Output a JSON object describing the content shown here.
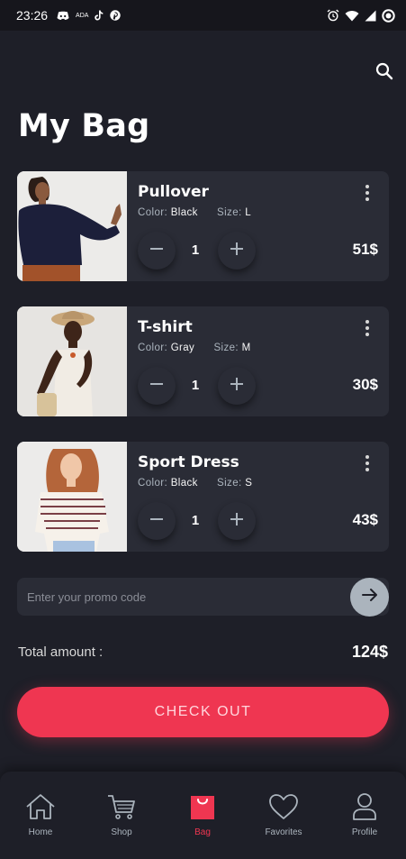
{
  "status_bar": {
    "time": "23:26",
    "small_label": "ADA",
    "icons": [
      "discord-icon",
      "ada-label",
      "tiktok-icon",
      "pinterest-icon",
      "alarm-icon",
      "wifi-icon",
      "signal-icon",
      "battery-icon"
    ]
  },
  "header": {
    "title": "My Bag",
    "search_icon": "search-icon"
  },
  "items": [
    {
      "name": "Pullover",
      "color_label": "Color:",
      "color": "Black",
      "size_label": "Size:",
      "size": "L",
      "qty": "1",
      "price": "51$",
      "photo": "woman-in-navy-pullover-photo"
    },
    {
      "name": "T-shirt",
      "color_label": "Color:",
      "color": "Gray",
      "size_label": "Size:",
      "size": "M",
      "qty": "1",
      "price": "30$",
      "photo": "woman-in-straw-hat-photo"
    },
    {
      "name": "Sport Dress",
      "color_label": "Color:",
      "color": "Black",
      "size_label": "Size:",
      "size": "S",
      "qty": "1",
      "price": "43$",
      "photo": "woman-in-striped-tee-photo"
    }
  ],
  "promo": {
    "placeholder": "Enter your promo code",
    "value": ""
  },
  "total": {
    "label": "Total amount :",
    "value": "124$"
  },
  "checkout": {
    "label": "CHECK OUT"
  },
  "nav": [
    {
      "label": "Home",
      "icon": "home-icon",
      "active": false
    },
    {
      "label": "Shop",
      "icon": "cart-icon",
      "active": false
    },
    {
      "label": "Bag",
      "icon": "bag-icon",
      "active": true
    },
    {
      "label": "Favorites",
      "icon": "heart-icon",
      "active": false
    },
    {
      "label": "Profile",
      "icon": "person-icon",
      "active": false
    }
  ],
  "colors": {
    "background": "#1e1f28",
    "card": "#2a2c36",
    "accent": "#ef3651",
    "muted": "#abb4bd"
  }
}
